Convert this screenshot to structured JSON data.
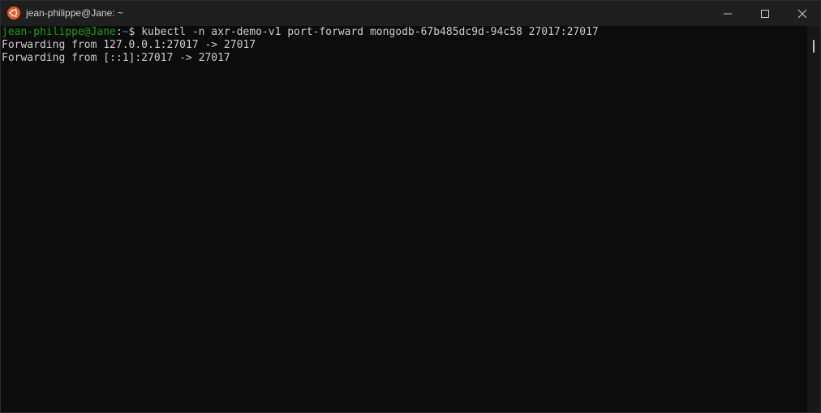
{
  "window": {
    "title": "jean-philippe@Jane: ~",
    "app_icon": "ubuntu-logo-icon",
    "controls": {
      "minimize_icon": "minimize-icon",
      "maximize_icon": "maximize-icon",
      "close_icon": "close-icon"
    },
    "colors": {
      "titlebar": "#1f1f1f",
      "terminal_bg": "#0c0c0c",
      "text": "#cccccc",
      "prompt_user": "#13a10e",
      "prompt_path": "#3b78ff",
      "ubuntu_orange": "#e95420"
    }
  },
  "terminal": {
    "prompt": {
      "user_host": "jean-philippe@Jane",
      "separator": ":",
      "path": "~",
      "symbol": "$ ",
      "command": "kubectl -n axr-demo-v1 port-forward mongodb-67b485dc9d-94c58 27017:27017"
    },
    "output": [
      "Forwarding from 127.0.0.1:27017 -> 27017",
      "Forwarding from [::1]:27017 -> 27017"
    ]
  }
}
